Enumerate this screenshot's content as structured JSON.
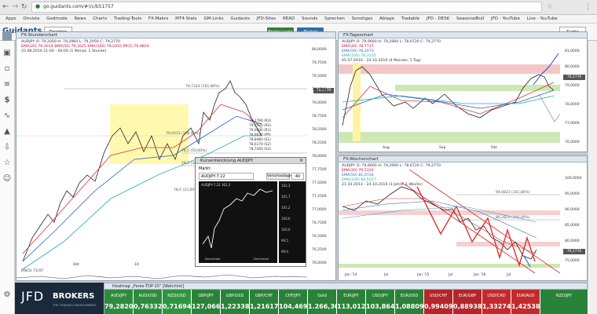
{
  "browser": {
    "url": "go.guidants.com/#!/c/b51757",
    "bookmarks": [
      "Apps",
      "Onvista",
      "Godmode",
      "News",
      "Charts",
      "Trading-Tools",
      "FX-Makro",
      "MT4-Stats",
      "GM-Links",
      "Guidants",
      "JFD-Sites",
      "READ",
      "Sounds",
      "Sprechen",
      "Sonstiges",
      "Ablage",
      "Tradable",
      "JFD - DESK",
      "SeasonalBull",
      "JFD - YouTube",
      "Live - YouTube"
    ]
  },
  "app": {
    "logo": "Guidants",
    "tab": "Desktop",
    "broker_login": "Broker Login",
    "market": "Market",
    "search": "Suche"
  },
  "rail_icons": [
    "monitor-icon",
    "chat-icon",
    "list-icon",
    "dollar-icon",
    "pulse-icon",
    "chart-icon",
    "download-icon",
    "star-icon",
    "user-icon"
  ],
  "hourly": {
    "title": "FX-Stundenchart",
    "legend": [
      "AUDJPY  O: 79,2050  H: 79,2960  L: 79,2050  C: 79,2770",
      "EMA(20) 79,3014  EMA(50) 79,1625  EMA(100) 79,2455  PP(1) 79,9820",
      "25.08.2016 21:00 - 00:00 (1 Monat, 1 Stunde)"
    ],
    "fib_labels": [
      "79,7324 (161,80%)",
      "79,0315 (100,00%)",
      "78,5 (50,00%)",
      "78,3 (38,20%)",
      "78,0 (23,60%)"
    ],
    "pivots": [
      "79,1790 (R3)",
      "79,1070 (R2)",
      "79,0240 (R1)",
      "78,9630 (PP)",
      "78,8480 (S1)",
      "78,6170 (S2)",
      "78,7440 (S3)"
    ],
    "last_price": "79,2770",
    "yaxis": [
      "80,0000",
      "79,7500",
      "79,5000",
      "79,2500",
      "79,0000",
      "78,7500",
      "78,5000",
      "78,2500",
      "78,0000",
      "77,7500",
      "77,5000",
      "77,2500",
      "77,0000",
      "76,7500",
      "76,5000",
      "76,2500",
      "76,0000"
    ],
    "xaxis": [
      "Okt",
      "10"
    ],
    "rsi": "RSI(5) 73,97"
  },
  "daily": {
    "title": "FX-Tageschart",
    "legend": [
      "AUDJPY  O: 79,9600  H: 79,2960  L: 78,6720  C: 79,2770",
      "EMA(20) 78,7717",
      "EMA(50) 78,2073",
      "EMA(100) 78,3155",
      "05.07.2016 - 24.10.2016 (4 Monate, 1 Tag)"
    ],
    "yaxis": [
      "81,0000",
      "80,0000",
      "79,0000",
      "78,0000",
      "77,0000",
      "76,0000"
    ],
    "last_price": "79,2770",
    "xaxis": [
      "Aug",
      "Sep",
      "Okt"
    ]
  },
  "weekly": {
    "title": "FX-Wochenchart",
    "legend": [
      "AUDJPY  O: 79,9600  H: 79,2960  L: 78,6720  C: 79,2770",
      "EMA(20) 79,5310",
      "EMA(50) 81,0724",
      "EMA(100) 84,5257",
      "21.10.2013 - 24.10.2016 (3 Jahre, 1 Woche)"
    ],
    "fib_labels": [
      "94,6823 (161,80%)",
      "86,2820 (100,00%)"
    ],
    "yaxis": [
      "100,0000",
      "95,0000",
      "90,0000",
      "85,0000",
      "80,0000",
      "75,0000"
    ],
    "last_price": "79,2770",
    "xaxis": [
      "Jan '14",
      "Jul",
      "Jan '15",
      "Jul",
      "Jan '16",
      "Jul"
    ]
  },
  "snapshot": {
    "window_title": "Kursentwicklung AUDJPY",
    "field_label": "Markt:",
    "field_value": "AUDJPY-7.22",
    "button": "Vorschautage",
    "days": "40",
    "mini_legend": "AUDJPY-7.22  162,2",
    "yaxis": [
      "102,3",
      "101,7",
      "101,2",
      "100,6",
      "100,0",
      "99,5",
      "99,0"
    ],
    "xaxis": [
      "November",
      "Dezember"
    ]
  },
  "heatmap": {
    "title": "Heatmap „Forex-TOP-15“ [Watchlist]",
    "cells": [
      {
        "sym": "AUD/JPY",
        "px": "79,28200",
        "color": "#2e8b3d"
      },
      {
        "sym": "AUD/USD",
        "px": "0,76332",
        "color": "#2e8b3d"
      },
      {
        "sym": "NZD/USD",
        "px": "0,71694",
        "color": "#2f9440"
      },
      {
        "sym": "GBP/JPY",
        "px": "127,06600",
        "color": "#2a8238"
      },
      {
        "sym": "GBP/USD",
        "px": "1,22338",
        "color": "#2a8238"
      },
      {
        "sym": "GBP/CHF",
        "px": "1,21617",
        "color": "#2a8238"
      },
      {
        "sym": "CHF/JPY",
        "px": "104,46900",
        "color": "#2a8238"
      },
      {
        "sym": "Gold",
        "px": "1.266,30",
        "color": "#2a8238"
      },
      {
        "sym": "EUR/JPY",
        "px": "113,01200",
        "color": "#2a8238"
      },
      {
        "sym": "USD/JPY",
        "px": "103,86400",
        "color": "#2a8238"
      },
      {
        "sym": "EUR/USD",
        "px": "1,08809",
        "color": "#2a8238"
      },
      {
        "sym": "USD/CHF",
        "px": "0,99409",
        "color": "#b3262a"
      },
      {
        "sym": "EUR/GBP",
        "px": "0,88938",
        "color": "#b3262a"
      },
      {
        "sym": "USD/CAD",
        "px": "1,33274",
        "color": "#c42a2d"
      },
      {
        "sym": "EUR/AUD",
        "px": "1,42538",
        "color": "#c42a2d"
      },
      {
        "sym": "NZD/JPY",
        "px": "",
        "color": "#2a8238"
      }
    ]
  },
  "broker_ad": {
    "brand": "JFD",
    "brokers": "BROKERS",
    "tagline": "THE TRADING ENVIRONMENT"
  }
}
